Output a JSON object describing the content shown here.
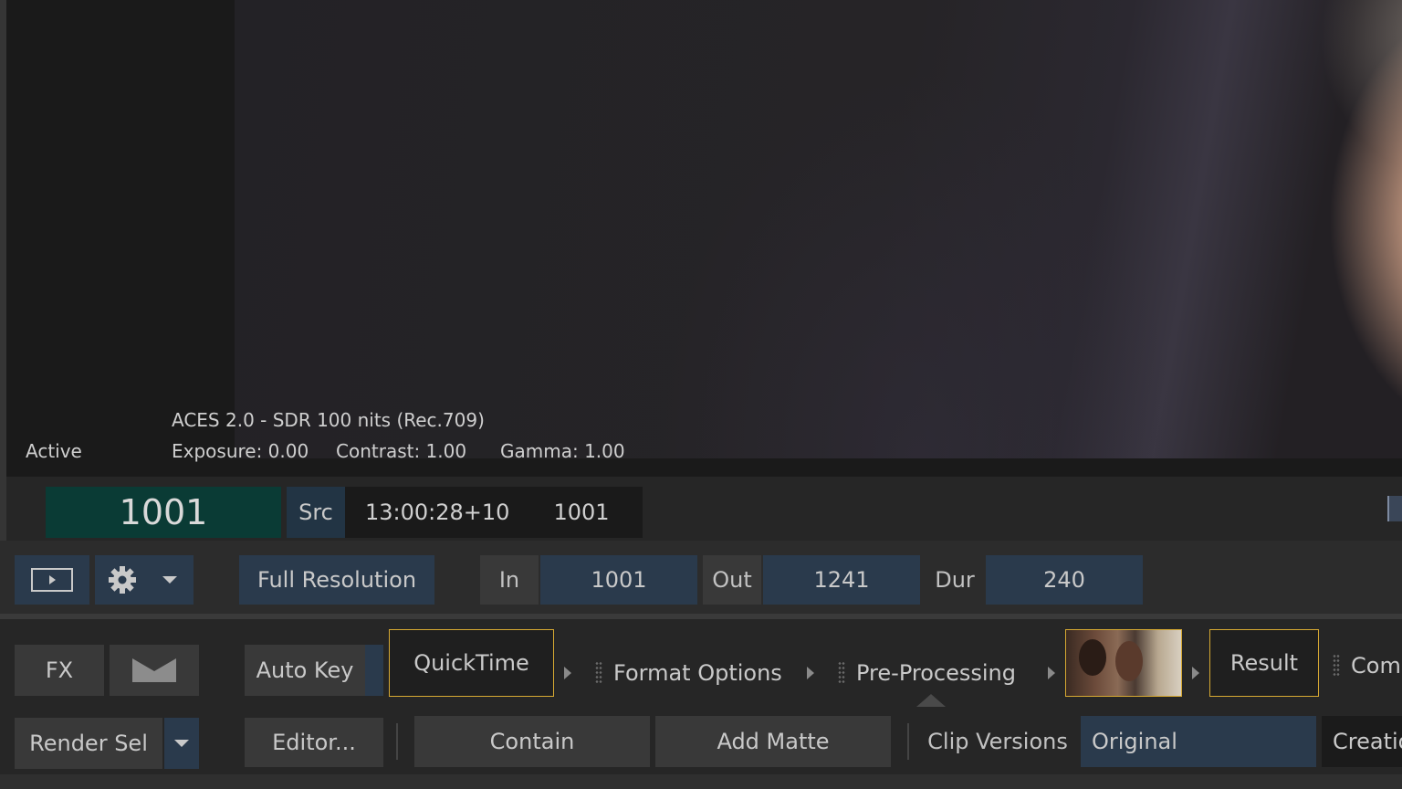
{
  "viewer": {
    "status": "Active",
    "colorspace": "ACES 2.0 - SDR 100 nits (Rec.709)",
    "exposure": "Exposure: 0.00",
    "contrast": "Contrast: 1.00",
    "gamma": "Gamma: 1.00"
  },
  "timecode": {
    "frame": "1001",
    "src_label": "Src",
    "tc": "13:00:28+10",
    "src_frame": "1001"
  },
  "controls": {
    "resolution": "Full Resolution",
    "in_label": "In",
    "in_value": "1001",
    "out_label": "Out",
    "out_value": "1241",
    "dur_label": "Dur",
    "dur_value": "240"
  },
  "pipeline": {
    "fx": "FX",
    "auto_key": "Auto Key",
    "quicktime": "QuickTime",
    "format_options": "Format Options",
    "pre_processing": "Pre-Processing",
    "result": "Result",
    "comp": "Comp"
  },
  "bottom": {
    "render_sel": "Render Sel",
    "editor": "Editor...",
    "contain": "Contain",
    "add_matte": "Add Matte",
    "clip_versions": "Clip Versions",
    "original": "Original",
    "creation": "Creatio"
  },
  "icons": {
    "play": "play-icon",
    "gear": "gear-icon",
    "dropdown": "chevron-down-icon",
    "matte": "matte-icon"
  },
  "colors": {
    "selection_border": "#d7a932",
    "frame_counter_bg": "#0a3b35",
    "blue_button": "#2a3a4c"
  }
}
